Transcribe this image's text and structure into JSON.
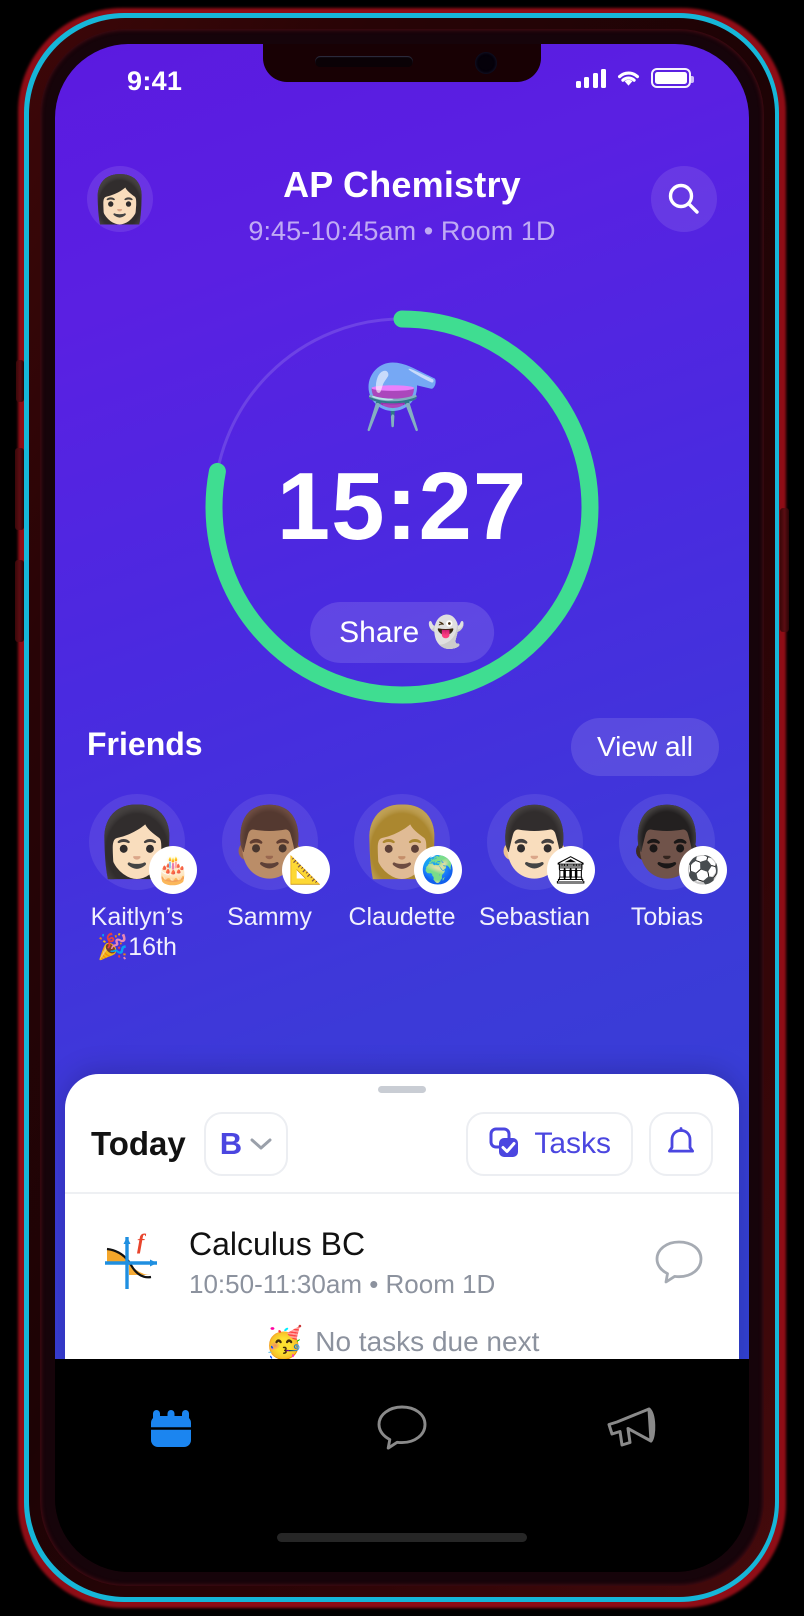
{
  "device": {
    "frame_color": "#2a0406",
    "accent_edge": "#16b6d8"
  },
  "statusbar": {
    "clock": "9:41",
    "signal_icon": "cellular-signal-icon",
    "wifi_icon": "wifi-icon",
    "battery_icon": "battery-full-icon"
  },
  "header": {
    "title": "AP Chemistry",
    "subtitle": "9:45-10:45am • Room 1D",
    "avatar_icon": "avatar",
    "search_icon": "search-icon"
  },
  "timer": {
    "emoji": "⚗️",
    "value": "15:27",
    "share_label": "Share 👻",
    "progress_percent": 78,
    "ring_color": "#3fdd91",
    "track_color": "rgba(255,255,255,0.14)"
  },
  "friends": {
    "title": "Friends",
    "view_all_label": "View all",
    "items": [
      {
        "name": "Kaitlyn’s\n🎉16th",
        "face": "👩🏻",
        "badge": "🎂",
        "badge_name": "birthday-cake-badge"
      },
      {
        "name": "Sammy",
        "face": "👨🏽",
        "badge": "📐",
        "badge_name": "calculus-badge"
      },
      {
        "name": "Claudette",
        "face": "👩🏼",
        "badge": "🌍",
        "badge_name": "globe-badge"
      },
      {
        "name": "Sebastian",
        "face": "👨🏻",
        "badge": "🏛",
        "badge_name": "history-column-badge"
      },
      {
        "name": "Tobias",
        "face": "👨🏿",
        "badge": "⚽",
        "badge_name": "sports-badge"
      }
    ]
  },
  "sheet": {
    "today_label": "Today",
    "day_letter": "B",
    "chevron_icon": "chevron-down-icon",
    "tasks_label": "Tasks",
    "tasks_icon": "tasks-checkbox-icon",
    "bell_icon": "bell-icon",
    "class": {
      "icon": "calculus-graph-icon",
      "name": "Calculus BC",
      "meta": "10:50-11:30am • Room 1D",
      "chat_icon": "chat-bubble-icon"
    },
    "no_tasks": {
      "emoji": "🥳",
      "text": "No tasks due next"
    }
  },
  "tabbar": {
    "items": [
      {
        "icon": "calendar-icon",
        "active": true
      },
      {
        "icon": "chat-bubble-icon",
        "active": false
      },
      {
        "icon": "megaphone-icon",
        "active": false
      }
    ],
    "active_color": "#1b85f0",
    "inactive_color": "#8a8a8a"
  }
}
